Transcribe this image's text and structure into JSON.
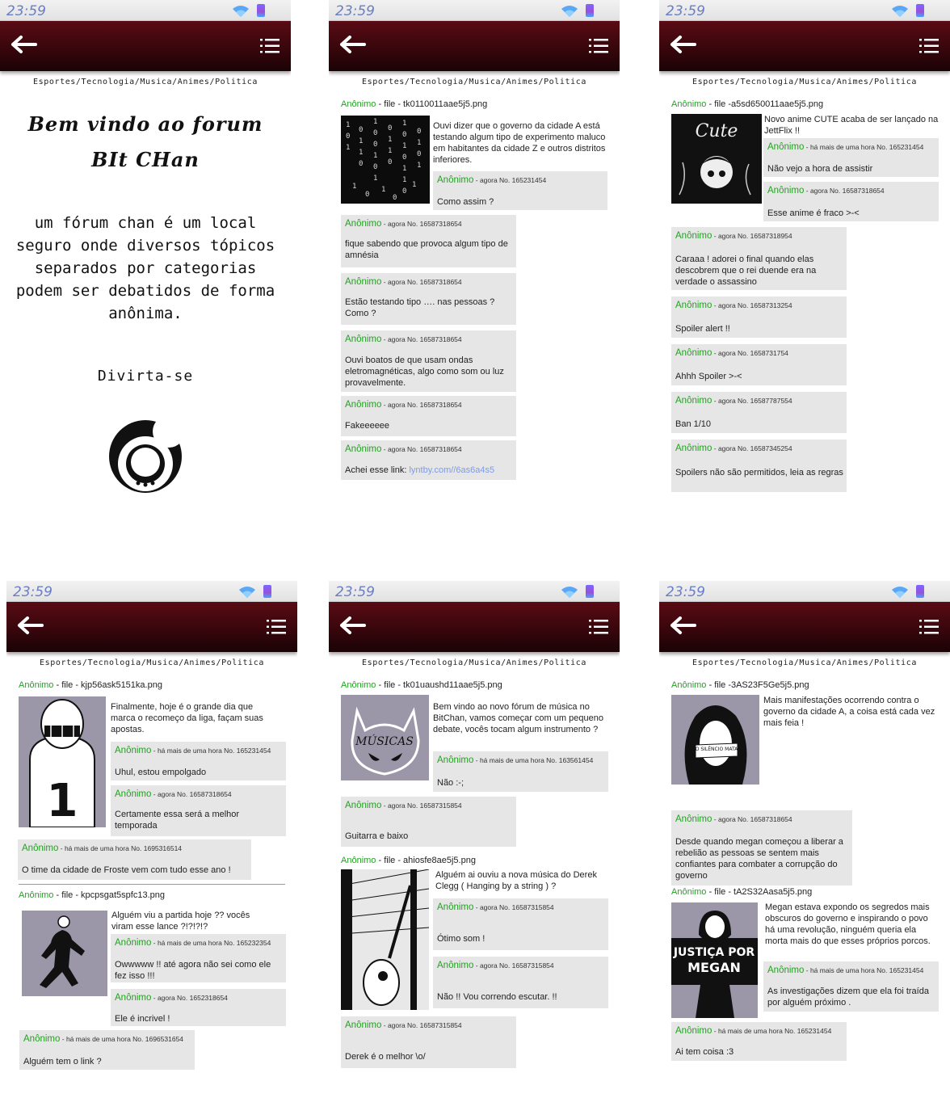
{
  "status": {
    "time": "23:59"
  },
  "categories": "Esportes/Tecnologia/Musica/Animes/Politica",
  "anon": "Anônimo",
  "screen1": {
    "title": "Bem vindo ao forum BIt CHan",
    "text": "um fórum chan é um local seguro onde diversos tópicos separados por categorias podem ser debatidos de forma anônima.",
    "fun": "Divirta-se"
  },
  "screen2": {
    "op_meta": " - file - tk0110011aae5j5.png",
    "op_text": "Ouvi dizer que o governo da cidade A está testando algum tipo de experimento maluco em habitantes da cidade Z e outros distritos inferiores.",
    "posts": [
      {
        "meta": " - agora No. 165231454",
        "text": "Como assim ?"
      },
      {
        "meta": " - agora No. 16587318654",
        "text": "fique sabendo que provoca algum tipo de amnésia"
      },
      {
        "meta": " - agora No. 16587318654",
        "text": "Estão testando tipo …. nas pessoas ? Como ?"
      },
      {
        "meta": " - agora No. 16587318654",
        "text": "Ouvi boatos de que usam ondas eletromagnéticas, algo como som ou luz provavelmente."
      },
      {
        "meta": " - agora No. 16587318654",
        "text": "Fakeeeeee"
      },
      {
        "meta": " - agora No. 16587318654",
        "text": "Achei esse link: ",
        "link": "lyntby.com//6as6a4s5"
      }
    ]
  },
  "screen3": {
    "op_meta": " - file -a5sd650011aae5j5.png",
    "op_text": "Novo anime CUTE acaba de ser lançado na JettFlix !!",
    "thumb_text": "Cute",
    "posts": [
      {
        "meta": " - há mais de uma hora No. 165231454",
        "text": "Não vejo a hora de assistir"
      },
      {
        "meta": " - agora No. 16587318654",
        "text": "Esse anime é fraco >-<"
      },
      {
        "meta": " - agora No. 16587318954",
        "text": "Caraaa ! adorei o final quando elas descobrem que o rei duende era na verdade o assassino"
      },
      {
        "meta": " - agora No. 16587313254",
        "text": "Spoiler alert !!"
      },
      {
        "meta": " - agora No. 1658731754",
        "text": "Ahhh Spoiler >-<"
      },
      {
        "meta": " - agora No. 16587787554",
        "text": "Ban 1/10"
      },
      {
        "meta": " - agora No. 16587345254",
        "text": "Spoilers não são permitidos, leia as regras"
      }
    ]
  },
  "screen4": {
    "op1_meta": " - file - kjp56ask5151ka.png",
    "op1_text": "Finalmente, hoje é o grande dia que marca o recomeço da liga, façam suas apostas.",
    "op2_meta": " - file - kpcpsgat5spfc13.png",
    "op2_text": "Alguém viu a partida hoje ?? vocês viram esse lance ?!?!?!?",
    "jersey_number": "1",
    "posts": [
      {
        "meta": " - há mais de uma hora No. 165231454",
        "text": "Uhul, estou empolgado"
      },
      {
        "meta": " - agora No. 16587318654",
        "text": "Certamente essa será a melhor temporada"
      },
      {
        "meta": " - há mais de uma hora No. 1695316514",
        "text": "O time da cidade de Froste vem com tudo esse ano !"
      },
      {
        "meta": " - há mais de uma hora No. 165232354",
        "text": "Owwwww !! até agora não sei como ele fez isso !!!"
      },
      {
        "meta": " - agora No. 1652318654",
        "text": "Ele é incrivel !"
      },
      {
        "meta": " - há mais de uma hora No. 1696531654",
        "text": "Alguém tem o link ?"
      }
    ]
  },
  "screen5": {
    "op1_meta": " - file - tk01uaushd11aae5j5.png",
    "op1_text": "Bem vindo ao novo fórum de música no BitChan, vamos começar com um pequeno debate, vocês tocam algum instrumento ?",
    "thumb_text": "MÚSICAS",
    "op2_meta": " - file - ahiosfe8ae5j5.png",
    "op2_text": "Alguém ai ouviu a nova música do Derek Clegg ( Hanging by a string ) ?",
    "posts": [
      {
        "meta": " - há mais de uma hora No. 163561454",
        "text": "Não :-;"
      },
      {
        "meta": " - agora No. 16587315854",
        "text": "Guitarra e baixo"
      },
      {
        "meta": " - agora No. 16587315854",
        "text": "Ótimo som !"
      },
      {
        "meta": " - agora No. 16587315854",
        "text": "Não !! Vou correndo escutar.  !!"
      },
      {
        "meta": " - agora No. 16587315854",
        "text": "Derek é o melhor \\o/"
      }
    ]
  },
  "screen6": {
    "op1_meta": " - file -3AS23F5Ge5j5.png",
    "op1_text": "Mais manifestações ocorrendo contra o governo da cidade A, a coisa está cada vez mais feia !",
    "mask_text": "O SILÊNCIO MATA",
    "op2_meta": " - file - tA2S32Aasa5j5.png",
    "op2_text": "Megan estava expondo os segredos mais obscuros do governo e inspirando o povo há uma revolução, ninguém queria ela morta mais do que esses próprios porcos.",
    "sign_line1": "JUSTIÇA POR",
    "sign_line2": "MEGAN",
    "posts": [
      {
        "meta": " - agora No. 16587318654",
        "text": "Desde quando megan começou a liberar a rebelião as pessoas se sentem mais confiantes para combater a corrupção do governo"
      },
      {
        "meta": " - há mais de uma hora No. 165231454",
        "text": "As investigações dizem que ela foi traída por alguém próximo ."
      },
      {
        "meta": " - há mais de uma hora No. 165231454",
        "text": "Ai tem coisa :3"
      }
    ]
  }
}
